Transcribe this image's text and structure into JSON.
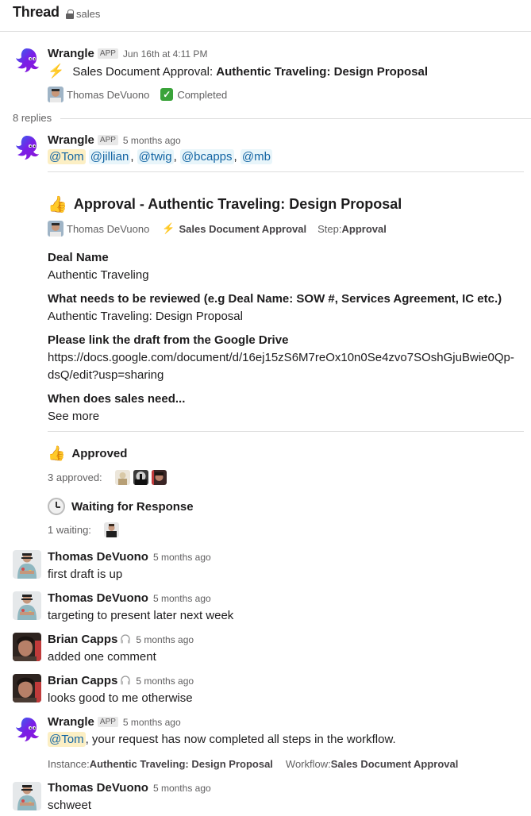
{
  "header": {
    "title": "Thread",
    "channel": "sales",
    "channel_icon": "lock-icon"
  },
  "parent": {
    "sender": "Wrangle",
    "badge": "APP",
    "timestamp": "Jun 16th at 4:11 PM",
    "workflow_prefix": "Sales Document Approval: ",
    "workflow_title": "Authentic Traveling: Design Proposal",
    "requester": "Thomas DeVuono",
    "status": "Completed",
    "status_icon": "checkmark-icon"
  },
  "replies_label": "8 replies",
  "replies": {
    "wrangle_request": {
      "sender": "Wrangle",
      "badge": "APP",
      "timestamp": "5 months ago",
      "mentions": [
        "@Tom",
        "@jillian",
        "@twig",
        "@bcapps",
        "@mb"
      ],
      "separator": ",",
      "card": {
        "title": "Approval - Authentic Traveling: Design Proposal",
        "requester": "Thomas DeVuono",
        "workflow": "Sales Document Approval",
        "step_label": "Step: ",
        "step_value": "Approval",
        "fields": [
          {
            "label": "Deal Name",
            "value": "Authentic Traveling"
          },
          {
            "label": "What needs to be reviewed (e.g Deal Name: SOW #, Services Agreement, IC etc.)",
            "value": "Authentic Traveling: Design Proposal"
          },
          {
            "label": "Please link the draft from the Google Drive",
            "value_line1": "https://docs.google.com/document/d/16ej15zS6M7reOx10n0Se4zvo7SOshGjuBwie0Qp-",
            "value_line2": "dsQ/edit?usp=sharing"
          },
          {
            "label": "When does sales need..."
          }
        ],
        "see_more": "See more",
        "approved_title": "Approved",
        "approved_count_label": "3 approved:",
        "waiting_title": "Waiting for Response",
        "waiting_count_label": "1 waiting:"
      }
    },
    "messages": [
      {
        "sender": "Thomas DeVuono",
        "timestamp": "5 months ago",
        "text": "first draft is up"
      },
      {
        "sender": "Thomas DeVuono",
        "timestamp": "5 months ago",
        "text": "targeting to present later next week"
      },
      {
        "sender": "Brian Capps",
        "status_icon": "headphones-icon",
        "timestamp": "5 months ago",
        "text": "added one comment"
      },
      {
        "sender": "Brian Capps",
        "status_icon": "headphones-icon",
        "timestamp": "5 months ago",
        "text": "looks good to me otherwise"
      }
    ],
    "wrangle_complete": {
      "sender": "Wrangle",
      "badge": "APP",
      "timestamp": "5 months ago",
      "mention": "@Tom",
      "text": ", your request has now completed all steps in the workflow.",
      "instance_label": "Instance: ",
      "instance_value": "Authentic Traveling: Design Proposal",
      "workflow_label": "Workflow: ",
      "workflow_value": "Sales Document Approval"
    },
    "last": {
      "sender": "Thomas DeVuono",
      "timestamp": "5 months ago",
      "text": "schweet"
    }
  },
  "colors": {
    "link": "#1264a3",
    "mention_bg": "#e8f5fa",
    "self_mention_bg": "#fcefc4",
    "wrangle_purple": "#6a1fe0"
  }
}
